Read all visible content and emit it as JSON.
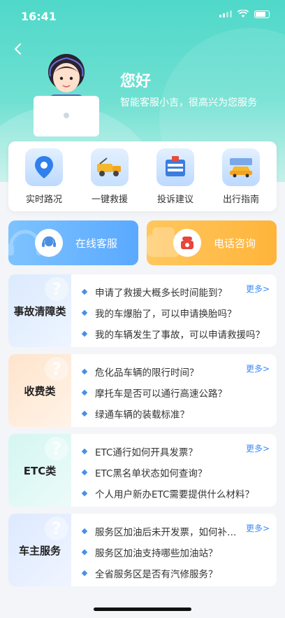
{
  "status": {
    "time": "16:41"
  },
  "hero": {
    "greeting": "您好",
    "subtitle": "智能客服小吉，很高兴为您服务"
  },
  "quick": [
    {
      "label": "实时路况",
      "icon": "map-pin-icon"
    },
    {
      "label": "一键救援",
      "icon": "tow-truck-icon"
    },
    {
      "label": "投诉建议",
      "icon": "feedback-icon"
    },
    {
      "label": "出行指南",
      "icon": "car-guide-icon"
    }
  ],
  "contact": {
    "online": "在线客服",
    "phone": "电话咨询"
  },
  "more_label": "更多>",
  "faqs": [
    {
      "category": "事故清障类",
      "questions": [
        "申请了救援大概多长时间能到？",
        "我的车爆胎了，可以申请换胎吗？",
        "我的车辆发生了事故，可以申请救援吗？"
      ]
    },
    {
      "category": "收费类",
      "questions": [
        "危化品车辆的限行时间？",
        "摩托车是否可以通行高速公路？",
        "绿通车辆的装载标准？"
      ]
    },
    {
      "category": "ETC类",
      "questions": [
        "ETC通行如何开具发票？",
        "ETC黑名单状态如何查询？",
        "个人用户新办ETC需要提供什么材料？"
      ]
    },
    {
      "category": "车主服务",
      "questions": [
        "服务区加油后未开发票，如何补开？",
        "服务区加油支持哪些加油站？",
        "全省服务区是否有汽修服务？"
      ]
    }
  ],
  "colors": {
    "accent": "#3b8cf6",
    "hero": "#4fd8c9",
    "phone": "#ffb43a"
  }
}
